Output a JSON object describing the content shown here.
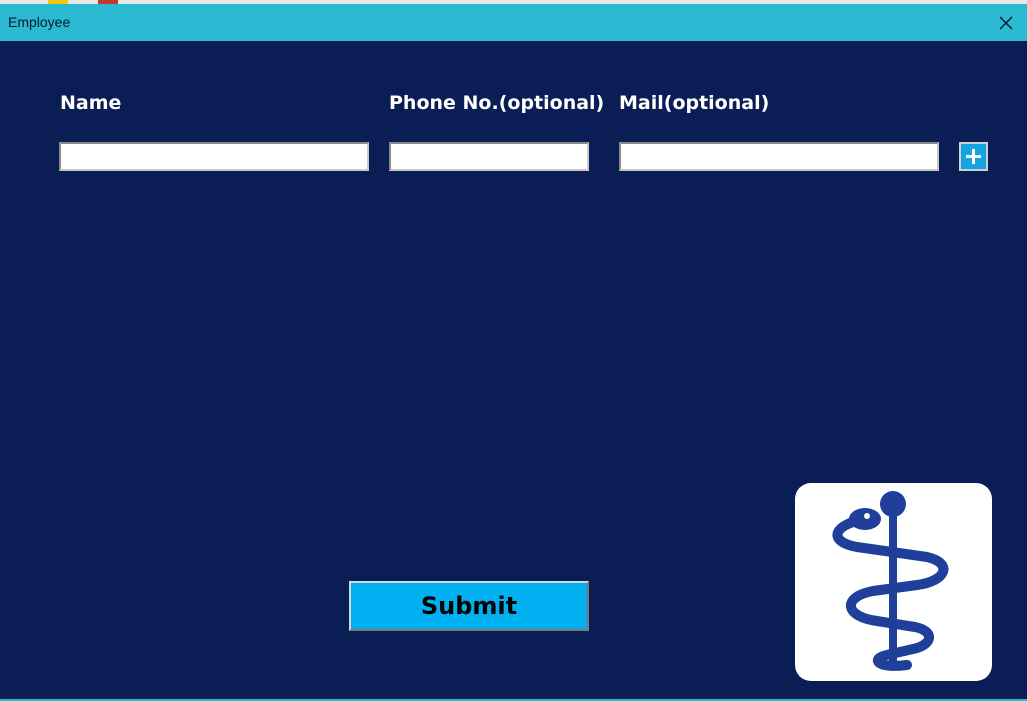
{
  "window": {
    "title": "Employee",
    "close_icon": "close-icon"
  },
  "form": {
    "name_label": "Name",
    "phone_label": "Phone No.(optional)",
    "mail_label": "Mail(optional)",
    "name_value": "",
    "phone_value": "",
    "mail_value": "",
    "add_icon": "plus-icon",
    "submit_label": "Submit"
  },
  "logo": {
    "icon": "medical-caduceus-icon"
  },
  "colors": {
    "background": "#0a1d55",
    "titlebar": "#29b9d1",
    "submit": "#00b0f0",
    "logo_symbol": "#1f3f9a"
  }
}
